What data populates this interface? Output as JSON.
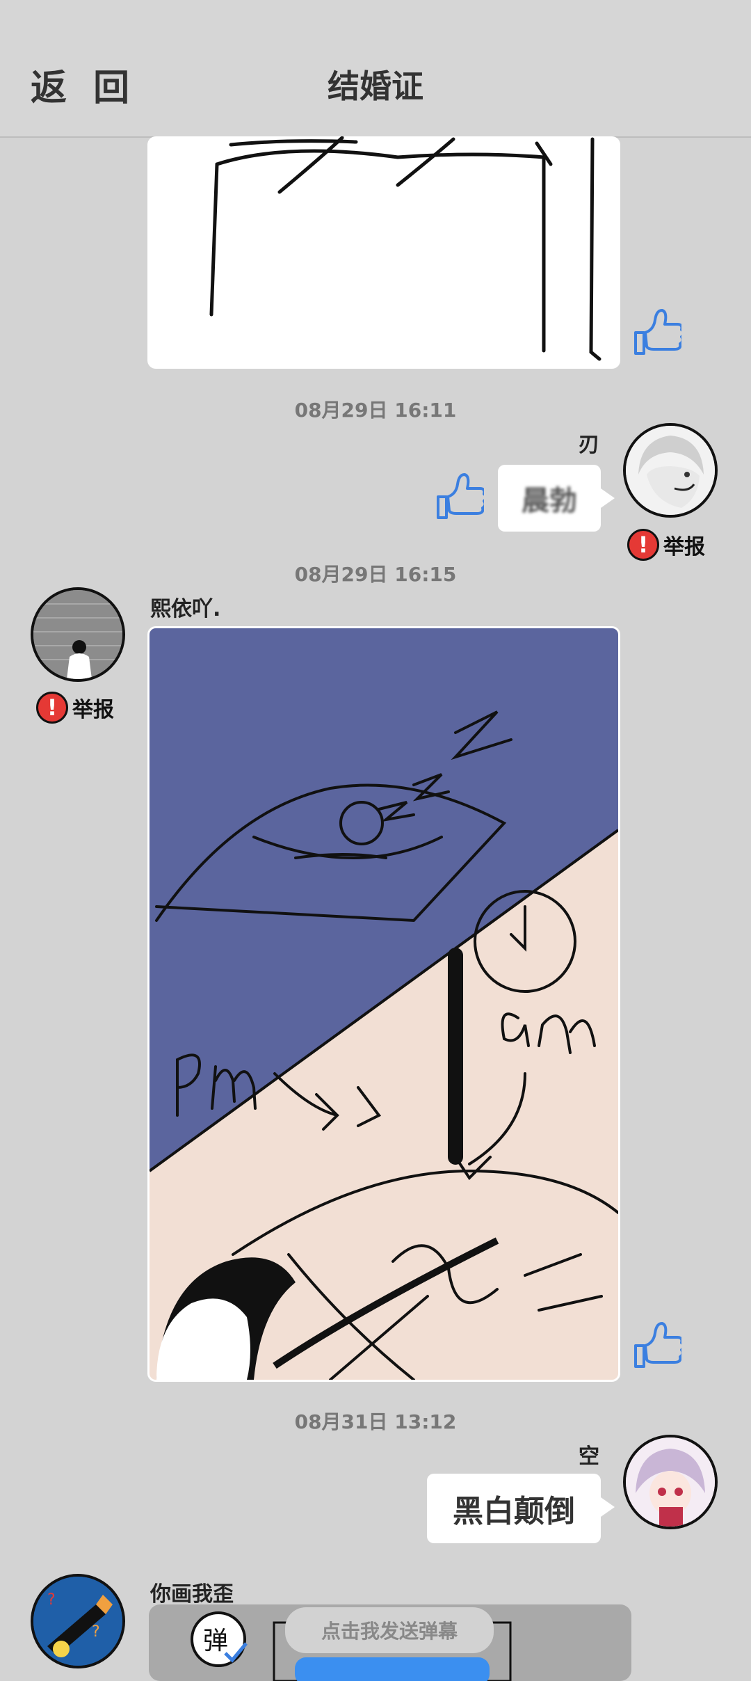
{
  "header": {
    "back_label": "返 回",
    "title": "结婚证"
  },
  "messages": [
    {
      "timestamp": "08月29日  16:11",
      "username": "刃",
      "text": "晨勃",
      "report_label": "举报"
    },
    {
      "timestamp": "08月29日  16:15",
      "username": "熙依吖.",
      "report_label": "举报"
    },
    {
      "timestamp": "08月31日  13:12",
      "username": "空",
      "text": "黑白颠倒"
    },
    {
      "username": "你画我歪"
    }
  ],
  "drawing_labels": {
    "pm": "P.m",
    "am": "a.m",
    "zzz": "ZZZ"
  },
  "danmu": {
    "label": "点击我发送弹幕"
  },
  "colors": {
    "background": "#d3d3d3",
    "night_blue": "#5b659e",
    "peach": "#f2dfd4",
    "like_blue": "#3b7fe0",
    "report_red": "#e53935"
  }
}
